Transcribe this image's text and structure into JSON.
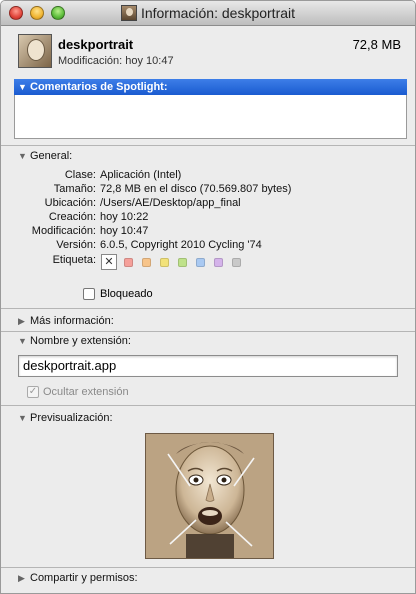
{
  "window": {
    "title": "Información: deskportrait",
    "title_icon": "app-portrait-icon"
  },
  "header": {
    "name": "deskportrait",
    "size": "72,8 MB",
    "modification": "Modificación:  hoy 10:47"
  },
  "spotlight": {
    "label": "Comentarios de Spotlight:",
    "value": ""
  },
  "general": {
    "label": "General:",
    "rows": [
      {
        "label": "Clase:",
        "value": "Aplicación (Intel)"
      },
      {
        "label": "Tamaño:",
        "value": "72,8 MB en el disco (70.569.807 bytes)"
      },
      {
        "label": "Ubicación:",
        "value": "/Users/AE/Desktop/app_final"
      },
      {
        "label": "Creación:",
        "value": "hoy 10:22"
      },
      {
        "label": "Modificación:",
        "value": "hoy 10:47"
      },
      {
        "label": "Versión:",
        "value": "6.0.5, Copyright 2010 Cycling '74"
      },
      {
        "label": "Etiqueta:",
        "value": ""
      }
    ],
    "tag_clear": "✕",
    "tag_colors": [
      "#f5a09a",
      "#f7c48a",
      "#f2e27a",
      "#bfe28a",
      "#a9c9f2",
      "#d4b3ea",
      "#c9c9c9"
    ],
    "locked_label": "Bloqueado",
    "locked": false
  },
  "more_info": {
    "label": "Más información:"
  },
  "name_ext": {
    "label": "Nombre y extensión:",
    "value": "deskportrait.app",
    "hide_ext_label": "Ocultar extensión",
    "hide_ext_checked": true
  },
  "preview": {
    "label": "Previsualización:"
  },
  "sharing": {
    "label": "Compartir y permisos:"
  },
  "colors": {
    "selection": "#1a5bd0",
    "window_bg": "#ececec"
  }
}
